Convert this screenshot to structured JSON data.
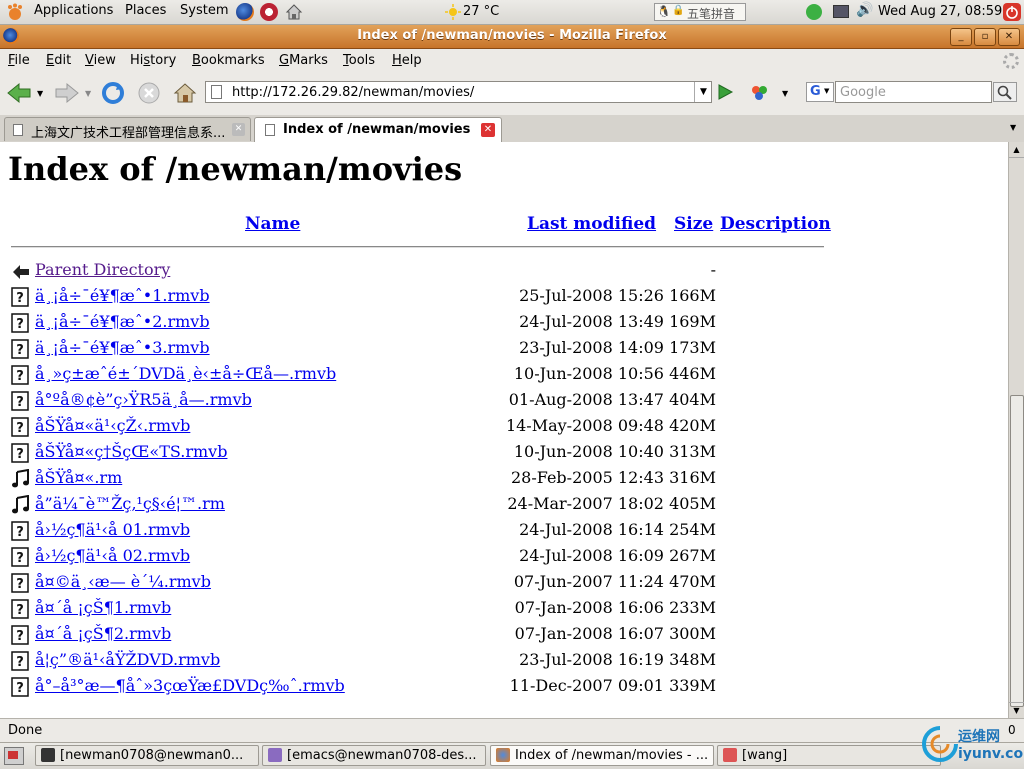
{
  "panel": {
    "menus": [
      "Applications",
      "Places",
      "System"
    ],
    "weather": "27 °C",
    "ime_label": "五笔拼音",
    "clock": "Wed Aug 27, 08:59"
  },
  "window": {
    "title": "Index of /newman/movies - Mozilla Firefox"
  },
  "menubar": {
    "items": [
      {
        "pre": "",
        "acc": "F",
        "post": "ile"
      },
      {
        "pre": "",
        "acc": "E",
        "post": "dit"
      },
      {
        "pre": "",
        "acc": "V",
        "post": "iew"
      },
      {
        "pre": "Hi",
        "acc": "s",
        "post": "tory"
      },
      {
        "pre": "",
        "acc": "B",
        "post": "ookmarks"
      },
      {
        "pre": "",
        "acc": "G",
        "post": "Marks"
      },
      {
        "pre": "",
        "acc": "T",
        "post": "ools"
      },
      {
        "pre": "",
        "acc": "H",
        "post": "elp"
      }
    ]
  },
  "navbar": {
    "url": "http://172.26.29.82/newman/movies/",
    "search_placeholder": "Google",
    "search_engine": "G"
  },
  "tabs": [
    {
      "label": "上海文广技术工程部管理信息系...",
      "active": false
    },
    {
      "label": "Index of /newman/movies",
      "active": true
    }
  ],
  "page": {
    "heading": "Index of /newman/movies",
    "columns": {
      "name": "Name",
      "modified": "Last modified",
      "size": "Size",
      "description": "Description"
    },
    "parent": {
      "name": "Parent Directory",
      "size": "-"
    },
    "files": [
      {
        "icon": "unknown",
        "name": "ä¸¡å÷¯é¥¶æˆ•1.rmvb",
        "date": "25-Jul-2008 15:26",
        "size": "166M"
      },
      {
        "icon": "unknown",
        "name": "ä¸¡å÷¯é¥¶æˆ•2.rmvb",
        "date": "24-Jul-2008 13:49",
        "size": "169M"
      },
      {
        "icon": "unknown",
        "name": "ä¸¡å÷¯é¥¶æˆ•3.rmvb",
        "date": "23-Jul-2008 14:09",
        "size": "173M"
      },
      {
        "icon": "unknown",
        "name": "å¸»ç±æˆé±´DVDä¸è‹±å÷Œå—.rmvb",
        "date": "10-Jun-2008 10:56",
        "size": "446M"
      },
      {
        "icon": "unknown",
        "name": "å°ºå®¢è”ç›ŸR5ä¸å—.rmvb",
        "date": "01-Aug-2008 13:47",
        "size": "404M"
      },
      {
        "icon": "unknown",
        "name": "åŠŸå¤«ä¹‹çŽ‹.rmvb",
        "date": "14-May-2008 09:48",
        "size": "420M"
      },
      {
        "icon": "unknown",
        "name": "åŠŸå¤«ç†ŠçŒ«TS.rmvb",
        "date": "10-Jun-2008 10:40",
        "size": "313M"
      },
      {
        "icon": "sound",
        "name": "åŠŸå¤«.rm",
        "date": "28-Feb-2005 12:43",
        "size": "316M"
      },
      {
        "icon": "sound",
        "name": "å”ä¼¯è™Žç‚¹ç§‹é¦™.rm",
        "date": "24-Mar-2007 18:02",
        "size": "405M"
      },
      {
        "icon": "unknown",
        "name": "å›½ç¶ä¹‹å 01.rmvb",
        "date": "24-Jul-2008 16:14",
        "size": "254M"
      },
      {
        "icon": "unknown",
        "name": "å›½ç¶ä¹‹å 02.rmvb",
        "date": "24-Jul-2008 16:09",
        "size": "267M"
      },
      {
        "icon": "unknown",
        "name": "å¤©ä¸‹æ— è´¼.rmvb",
        "date": "07-Jun-2007 11:24",
        "size": "470M"
      },
      {
        "icon": "unknown",
        "name": "å¤´å ¡çŠ¶1.rmvb",
        "date": "07-Jan-2008 16:06",
        "size": "233M"
      },
      {
        "icon": "unknown",
        "name": "å¤´å ¡çŠ¶2.rmvb",
        "date": "07-Jan-2008 16:07",
        "size": "300M"
      },
      {
        "icon": "unknown",
        "name": "å¦ç”®ä¹‹åŸŽDVD.rmvb",
        "date": "23-Jul-2008 16:19",
        "size": "348M"
      },
      {
        "icon": "unknown",
        "name": "å°–å³°æ—¶åˆ»3çœŸæ£DVDç‰ˆ.rmvb",
        "date": "11-Dec-2007 09:01",
        "size": "339M"
      }
    ]
  },
  "statusbar": {
    "text": "Done"
  },
  "taskbar": [
    {
      "label": "[newman0708@newman0...",
      "icon": "terminal"
    },
    {
      "label": "[emacs@newman0708-des...",
      "icon": "emacs"
    },
    {
      "label": "Index of /newman/movies - ...",
      "icon": "firefox"
    },
    {
      "label": "[wang]",
      "icon": "app"
    }
  ],
  "watermark": "运维网 iyunv.com",
  "colors": {
    "accent_title": "#d4853a",
    "link": "#0000ee",
    "visited": "#551a8b"
  }
}
